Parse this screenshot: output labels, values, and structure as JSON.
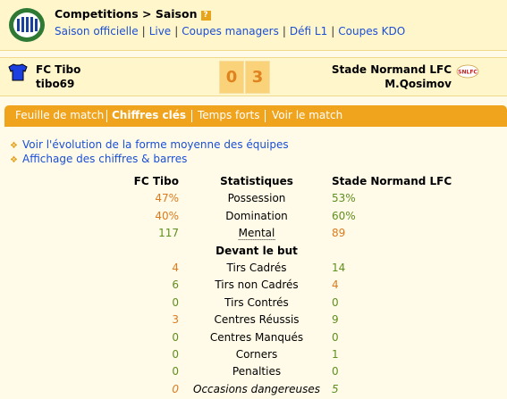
{
  "header": {
    "breadcrumb": "Competitions > Saison",
    "help": "?",
    "nav": [
      "Saison officielle",
      "Live",
      "Coupes managers",
      "Défi L1",
      "Coupes KDO"
    ],
    "nav_separator": "|"
  },
  "match": {
    "home_team": "FC Tibo",
    "home_manager": "tibo69",
    "home_score": "0",
    "away_score": "3",
    "away_team": "Stade Normand LFC",
    "away_manager": "M.Qosimov",
    "away_logo_text": "SNLFC"
  },
  "tabs": [
    "Feuille de match",
    "Chiffres clés",
    "Temps forts",
    "Voir le match"
  ],
  "active_tab": "Chiffres clés",
  "links": [
    "Voir l'évolution de la forme moyenne des équipes",
    "Affichage des chiffres & barres"
  ],
  "stats": {
    "header": {
      "home": "FC Tibo",
      "label": "Statistiques",
      "away": "Stade Normand LFC"
    },
    "general": [
      {
        "home": "47%",
        "label": "Possession",
        "away": "53%"
      },
      {
        "home": "40%",
        "label": "Domination",
        "away": "60%"
      },
      {
        "home": "117",
        "label": "Mental",
        "away": "89"
      }
    ],
    "section_title": "Devant le but",
    "attack": [
      {
        "home": "4",
        "label": "Tirs Cadrés",
        "away": "14"
      },
      {
        "home": "6",
        "label": "Tirs non Cadrés",
        "away": "4"
      },
      {
        "home": "0",
        "label": "Tirs Contrés",
        "away": "0"
      },
      {
        "home": "3",
        "label": "Centres Réussis",
        "away": "9"
      },
      {
        "home": "0",
        "label": "Centres Manqués",
        "away": "0"
      },
      {
        "home": "0",
        "label": "Corners",
        "away": "1"
      },
      {
        "home": "0",
        "label": "Penalties",
        "away": "0"
      },
      {
        "home": "0",
        "label": "Occasions dangereuses",
        "away": "5"
      }
    ]
  }
}
